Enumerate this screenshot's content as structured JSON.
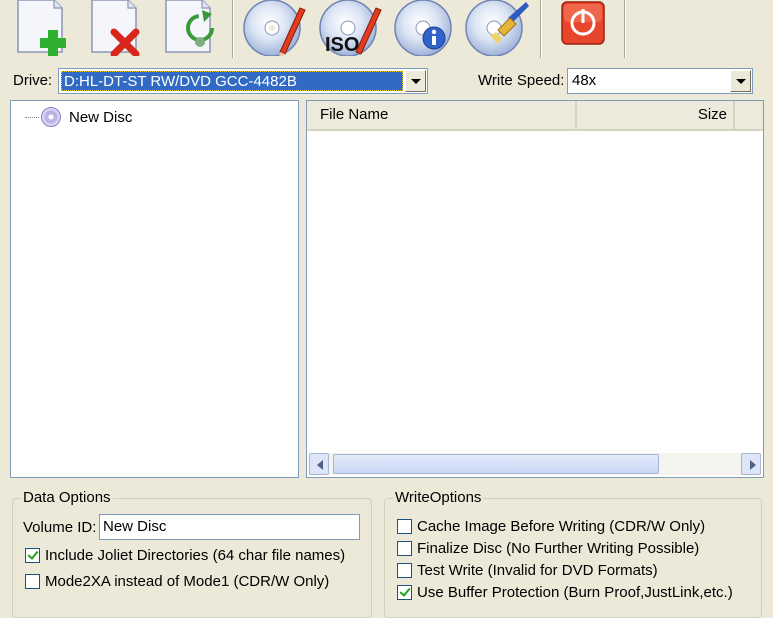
{
  "toolbar": {
    "buttons": [
      {
        "name": "add-files",
        "icon": "document-plus-icon"
      },
      {
        "name": "remove-files",
        "icon": "document-x-icon"
      },
      {
        "name": "refresh-files",
        "icon": "document-refresh-icon"
      },
      {
        "name": "burn-disc",
        "icon": "disc-burn-icon"
      },
      {
        "name": "burn-iso",
        "icon": "disc-iso-icon",
        "badge": "ISO"
      },
      {
        "name": "disc-info",
        "icon": "disc-info-icon"
      },
      {
        "name": "erase-disc",
        "icon": "disc-erase-icon"
      },
      {
        "name": "exit",
        "icon": "power-icon"
      }
    ]
  },
  "drive": {
    "label": "Drive:",
    "value": "D:HL-DT-ST RW/DVD GCC-4482B"
  },
  "write_speed": {
    "label": "Write Speed:",
    "value": "48x"
  },
  "tree": {
    "root_label": "New Disc"
  },
  "file_list": {
    "columns": [
      "File Name",
      "Size"
    ],
    "rows": []
  },
  "data_options": {
    "title": "Data Options",
    "volume_id_label": "Volume ID:",
    "volume_id_value": "New Disc",
    "checkboxes": [
      {
        "label": "Include Joliet Directories (64 char file names)",
        "checked": true
      },
      {
        "label": "Mode2XA instead of Mode1 (CDR/W Only)",
        "checked": false
      }
    ]
  },
  "write_options": {
    "title": "WriteOptions",
    "checkboxes": [
      {
        "label": "Cache Image Before Writing (CDR/W Only)",
        "checked": false
      },
      {
        "label": "Finalize Disc (No Further Writing Possible)",
        "checked": false
      },
      {
        "label": "Test Write (Invalid for DVD Formats)",
        "checked": false
      },
      {
        "label": "Use Buffer Protection (Burn Proof,JustLink,etc.)",
        "checked": true
      }
    ]
  },
  "colors": {
    "window_bg": "#ece9d8",
    "selection": "#316ac5",
    "exit_button": "#e8462c",
    "check_mark": "#21a121"
  }
}
